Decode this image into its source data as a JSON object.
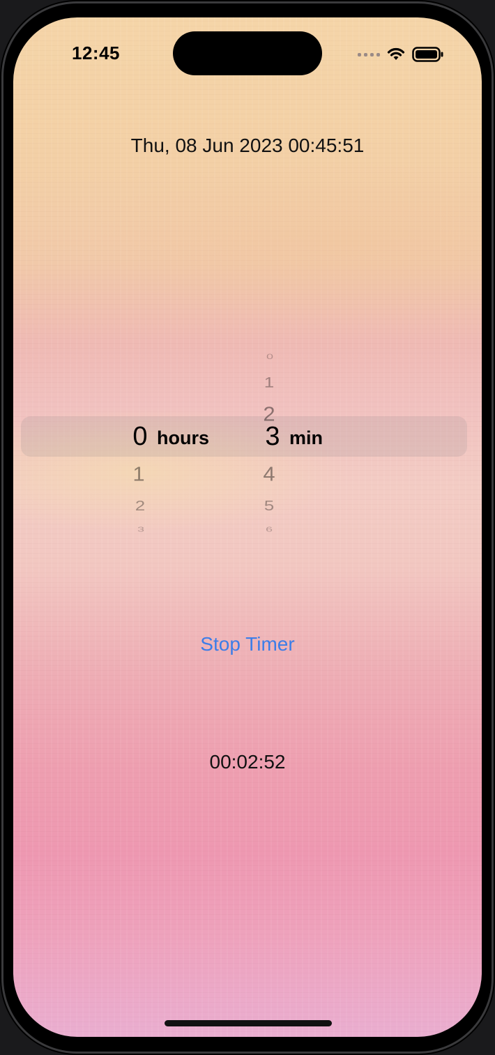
{
  "status_bar": {
    "time": "12:45"
  },
  "date_label": "Thu, 08 Jun 2023 00:45:51",
  "picker": {
    "hours": {
      "selected": "0",
      "unit": "hours",
      "below": [
        "1",
        "2",
        "3"
      ]
    },
    "minutes": {
      "selected": "3",
      "unit": "min",
      "above": [
        "0",
        "1",
        "2"
      ],
      "below": [
        "4",
        "5",
        "6"
      ]
    }
  },
  "stop_button_label": "Stop Timer",
  "timer_label": "00:02:52",
  "colors": {
    "accent": "#3b7de8"
  }
}
